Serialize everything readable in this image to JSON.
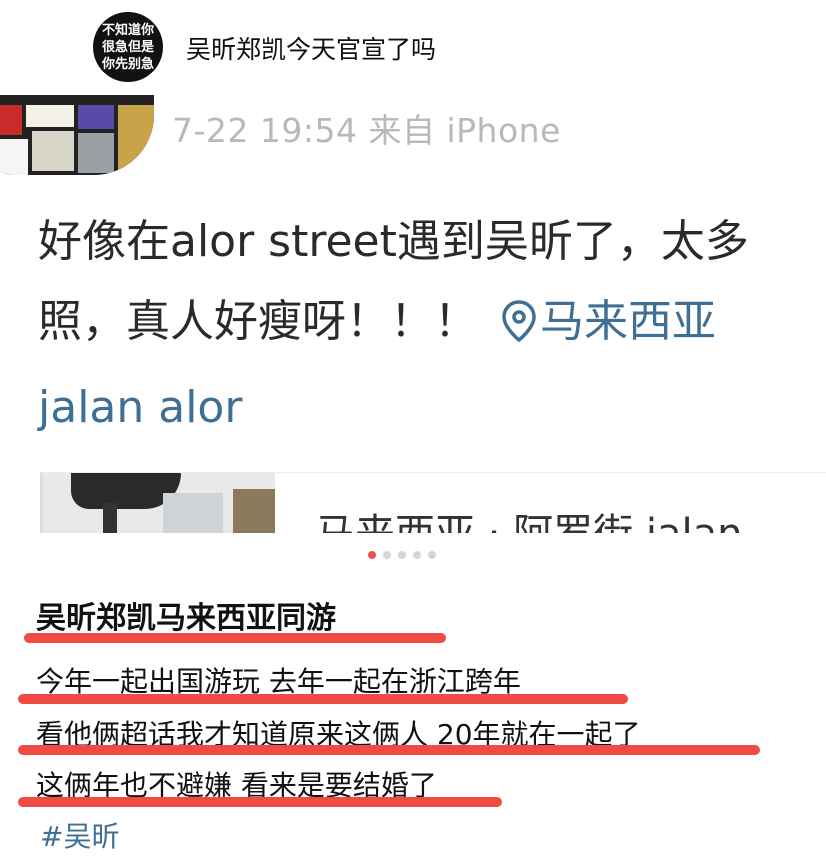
{
  "header": {
    "avatar_lines": [
      "不知道你",
      "很急但是",
      "你先别急"
    ],
    "title": "吴昕郑凯今天官宣了吗"
  },
  "post": {
    "meta": "7-22 19:54 来自 iPhone",
    "body_line1": "好像在alor street遇到吴昕了，太多",
    "body_line2": "照，真人好瘦呀！！！",
    "location_label": "马来西亚",
    "location_line3": "jalan alor",
    "card_text": "马来西亚 · 阿罗街 jalan",
    "carousel_count": 5,
    "carousel_active": 1
  },
  "caption": {
    "title": "吴昕郑凯马来西亚同游",
    "line1": "今年一起出国游玩 去年一起在浙江跨年",
    "line2": "看他俩超话我才知道原来这俩人 20年就在一起了",
    "line3": "这俩年也不避嫌 看来是要结婚了",
    "hashtag": "#吴昕"
  },
  "colors": {
    "link": "#3f6f93",
    "highlight": "#ef4a44",
    "meta": "#b8b8b8"
  },
  "icons": [
    "location-pin-icon"
  ]
}
